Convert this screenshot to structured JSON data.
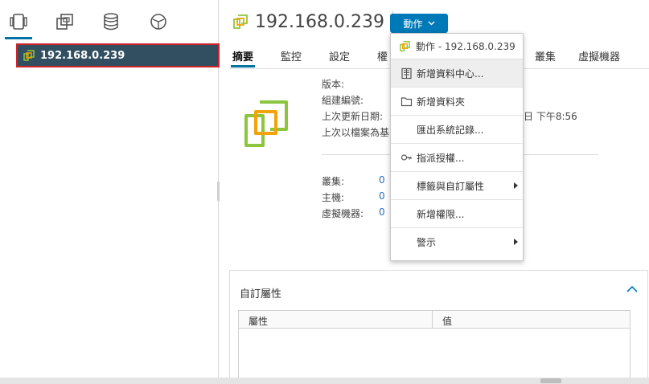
{
  "host": {
    "title": "192.168.0.239"
  },
  "navigator": {
    "tree_item_label": "192.168.0.239"
  },
  "toolbar": {
    "actions_label": "動作"
  },
  "tabs": [
    {
      "label": "摘要",
      "active": true
    },
    {
      "label": "監控"
    },
    {
      "label": "設定"
    },
    {
      "label": "權"
    },
    {
      "label": "叢集"
    },
    {
      "label": "虛擬機器"
    }
  ],
  "summary": {
    "version_label": "版本:",
    "build_label": "組建編號:",
    "last_updated_label": "上次更新日期:",
    "last_updated_value_tail": "日 下午8:56",
    "last_file_backup_label": "上次以檔案為基",
    "clusters_label": "叢集:",
    "clusters_value": "0",
    "hosts_label": "主機:",
    "hosts_value": "0",
    "vms_label": "虛擬機器:",
    "vms_value": "0"
  },
  "custom_attributes": {
    "title": "自訂屬性",
    "col_attribute": "屬性",
    "col_value": "值"
  },
  "actions_menu": {
    "header": "動作 - 192.168.0.239",
    "items": [
      {
        "label": "新增資料中心...",
        "icon": "datacenter-icon",
        "highlighted": true
      },
      {
        "label": "新增資料夾",
        "icon": "folder-icon"
      },
      {
        "label": "匯出系統記錄..."
      },
      {
        "label": "指派授權...",
        "icon": "key-icon"
      },
      {
        "label": "標籤與自訂屬性",
        "submenu": true
      },
      {
        "label": "新增權限..."
      },
      {
        "label": "警示",
        "submenu": true
      }
    ]
  },
  "colors": {
    "accent": "#0079b8",
    "selected_tree_bg": "#324f61",
    "selection_border": "#d0242b",
    "logo_green": "#8cc63f",
    "logo_orange": "#f0a30a"
  }
}
